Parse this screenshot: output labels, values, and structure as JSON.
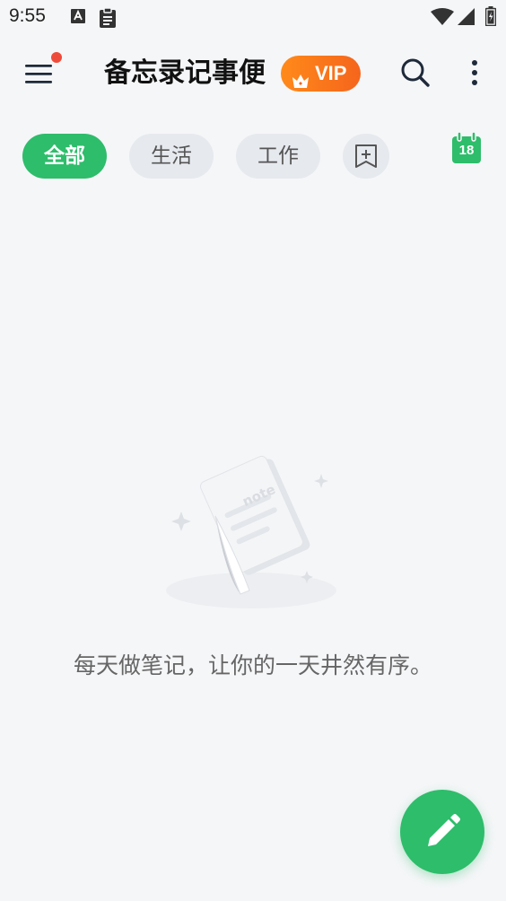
{
  "status_bar": {
    "time": "9:55",
    "icons": [
      "a-notification-icon",
      "clipboard-icon",
      "wifi-icon",
      "signal-icon",
      "battery-icon"
    ]
  },
  "app_bar": {
    "title": "备忘录记事便",
    "vip_label": "VIP",
    "icons": [
      "menu-icon",
      "crown-icon",
      "search-icon",
      "more-vertical-icon"
    ]
  },
  "tabs": [
    {
      "label": "全部",
      "active": true
    },
    {
      "label": "生活",
      "active": false
    },
    {
      "label": "工作",
      "active": false
    }
  ],
  "calendar": {
    "day": "18",
    "icon": "calendar-icon"
  },
  "empty_state": {
    "illustration": "note-paper-illustration",
    "illustration_label": "note",
    "message": "每天做笔记，让你的一天井然有序。"
  },
  "fab": {
    "icon": "pencil-icon"
  },
  "colors": {
    "accent_green": "#2ebd6b",
    "vip_orange": "#f5651c",
    "notification_red": "#ef4b3a",
    "background": "#f5f6f8",
    "chip_gray": "#e6e9ee"
  }
}
